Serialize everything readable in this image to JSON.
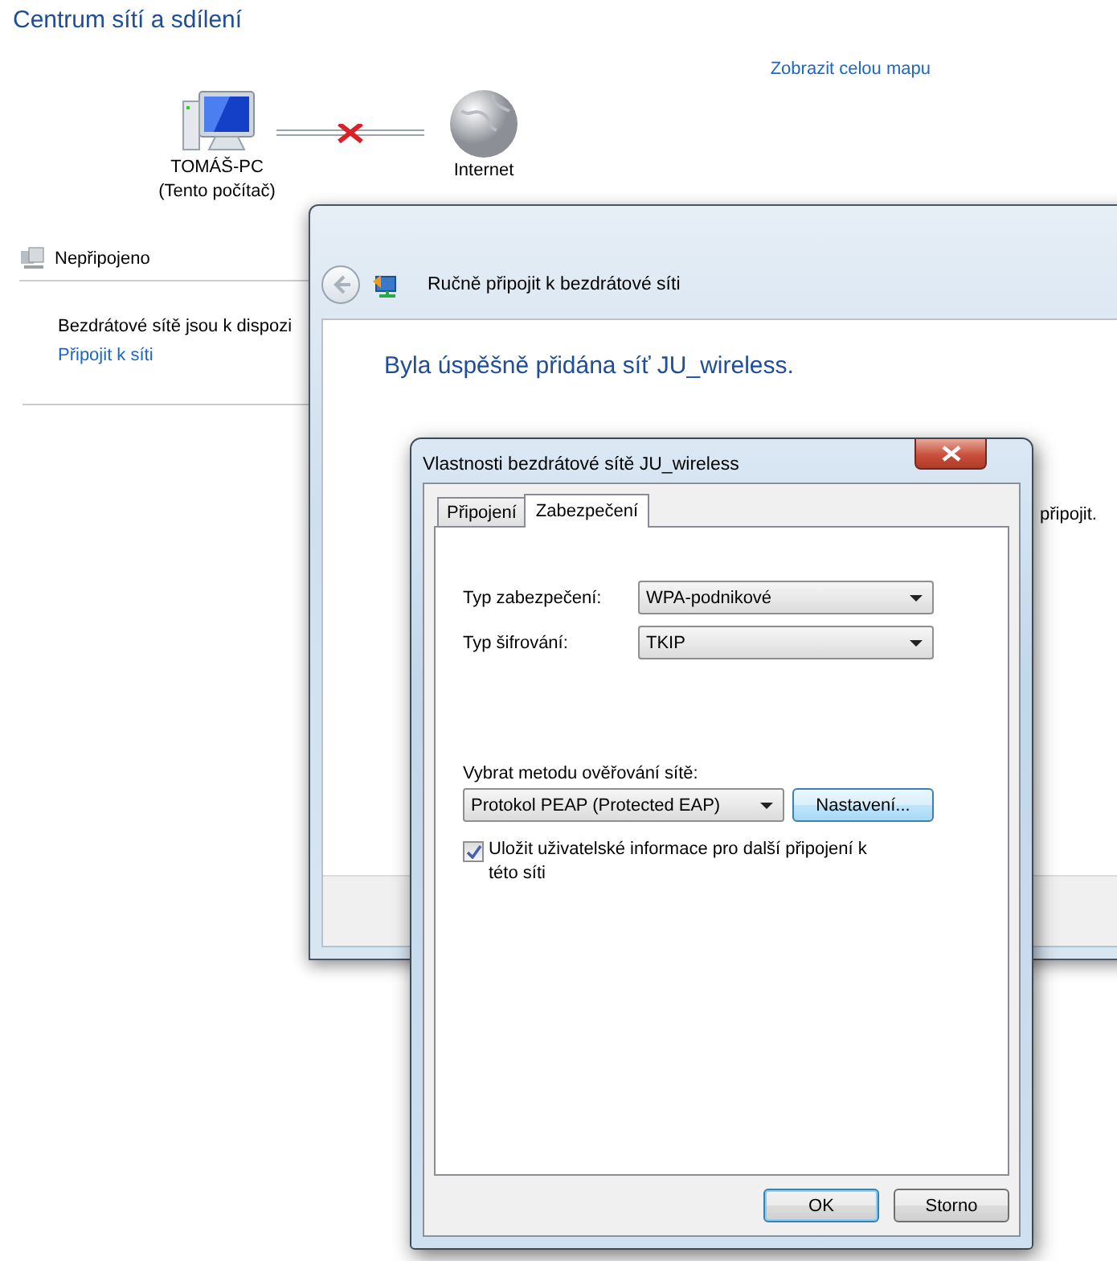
{
  "page": {
    "title": "Centrum sítí a sdílení",
    "map_link": "Zobrazit celou mapu",
    "map": {
      "computer_name": "TOMÁŠ-PC",
      "computer_note": "(Tento počítač)",
      "connected": false,
      "internet_label": "Internet"
    },
    "status": "Nepřipojeno",
    "wireless_text": "Bezdrátové sítě jsou k dispozi",
    "connect_link": "Připojit k síti"
  },
  "wizard": {
    "title": "Ručně připojit k bezdrátové síti",
    "heading": "Byla úspěšně přidána síť JU_wireless.",
    "partial_text": "připojit."
  },
  "dialog": {
    "title": "Vlastnosti bezdrátové sítě JU_wireless",
    "tabs": [
      {
        "label": "Připojení",
        "selected": false
      },
      {
        "label": "Zabezpečení",
        "selected": true
      }
    ],
    "fields": [
      {
        "label": "Typ zabezpečení:",
        "value": "WPA-podnikové"
      },
      {
        "label": "Typ šifrování:",
        "value": "TKIP"
      }
    ],
    "auth_label": "Vybrat metodu ověřování sítě:",
    "auth_method": "Protokol PEAP (Protected EAP)",
    "settings_button": "Nastavení...",
    "remember": {
      "label": "Uložit uživatelské informace pro další připojení k této síti",
      "checked": true
    },
    "buttons": [
      {
        "label": "OK",
        "default": true
      },
      {
        "label": "Storno",
        "default": false
      }
    ]
  }
}
